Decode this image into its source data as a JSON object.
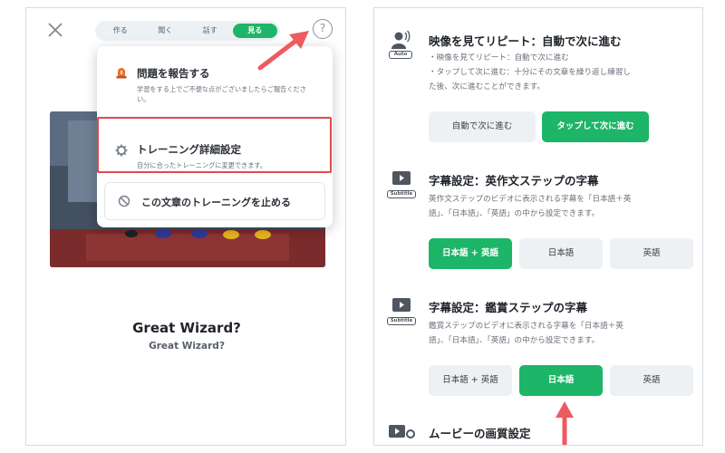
{
  "left": {
    "mode_tabs": [
      "作る",
      "聞く",
      "話す",
      "見る"
    ],
    "active_tab": "見る",
    "help_label": "?",
    "menu": {
      "report": {
        "title": "問題を報告する",
        "desc": "学習をする上でご不便な点がございましたらご報告ください。"
      },
      "training_settings": {
        "title": "トレーニング詳細設定",
        "desc": "自分に合ったトレーニングに変更できます。"
      },
      "stop": {
        "title": "この文章のトレーニングを止める"
      }
    },
    "title": "Great Wizard?",
    "subtitle": "Great Wizard?"
  },
  "right": {
    "repeat": {
      "title": "映像を見てリピート：自動で次に進む",
      "icon_caption": "Auto",
      "desc_lines": [
        "・映像を見てリピート：自動で次に進む",
        "・タップして次に進む：十分にその文章を繰り返し練習し",
        "た後、次に進むことができます。"
      ],
      "options": [
        "自動で次に進む",
        "タップして次に進む"
      ],
      "selected": "タップして次に進む"
    },
    "subtitle_en_step": {
      "title": "字幕設定：英作文ステップの字幕",
      "icon_caption": "Subtitle",
      "desc_lines": [
        "英作文ステップのビデオに表示される字幕を「日本語＋英",
        "語」、「日本語」、「英語」の中から設定できます。"
      ],
      "options": [
        "日本語 + 英語",
        "日本語",
        "英語"
      ],
      "selected": "日本語 + 英語"
    },
    "subtitle_view_step": {
      "title": "字幕設定：鑑賞ステップの字幕",
      "icon_caption": "Subtitle",
      "desc_lines": [
        "鑑賞ステップのビデオに表示される字幕を「日本語＋英",
        "語」、「日本語」、「英語」の中から設定できます。"
      ],
      "options": [
        "日本語 + 英語",
        "日本語",
        "英語"
      ],
      "selected": "日本語"
    },
    "movie_quality": {
      "title": "ムービーの画質設定"
    }
  },
  "colors": {
    "accent_green": "#1db567",
    "highlight_red": "#e0494d",
    "arrow_red": "#ef5a5f",
    "option_gray": "#eef1f4"
  }
}
